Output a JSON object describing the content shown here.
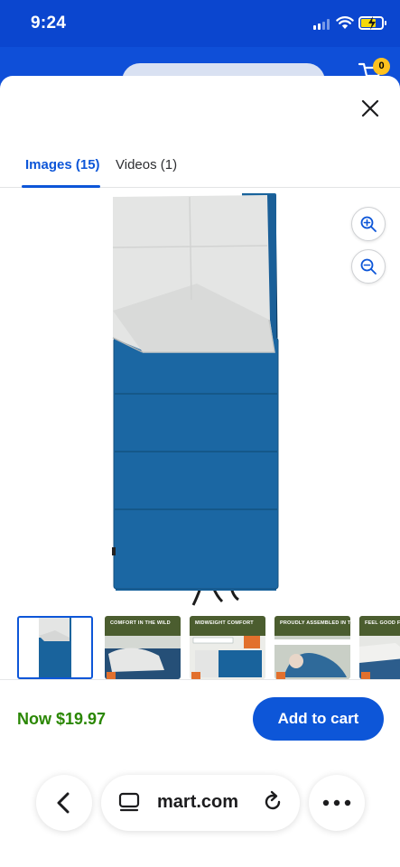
{
  "status_bar": {
    "time": "9:24"
  },
  "header": {
    "cart_count": "0"
  },
  "tabs": [
    {
      "label": "Images (15)",
      "active": true
    },
    {
      "label": "Videos (1)",
      "active": false
    }
  ],
  "thumbnails": [
    {
      "caption": "",
      "selected": true
    },
    {
      "caption": "COMFORT IN THE WILD",
      "selected": false
    },
    {
      "caption": "MIDWEIGHT COMFORT",
      "selected": false
    },
    {
      "caption": "PROUDLY ASSEMBLED IN THE USA",
      "selected": false
    },
    {
      "caption": "FEEL GOOD FABR",
      "selected": false
    }
  ],
  "footer": {
    "price": "Now $19.97",
    "add_to_cart": "Add to cart"
  },
  "browser": {
    "url": "mart.com"
  },
  "colors": {
    "brand_blue": "#0d56d8",
    "price_green": "#2a8703",
    "header_blue": "#0f4fd8",
    "bag_blue": "#19639c",
    "lining_grey": "#e4e5e4"
  }
}
